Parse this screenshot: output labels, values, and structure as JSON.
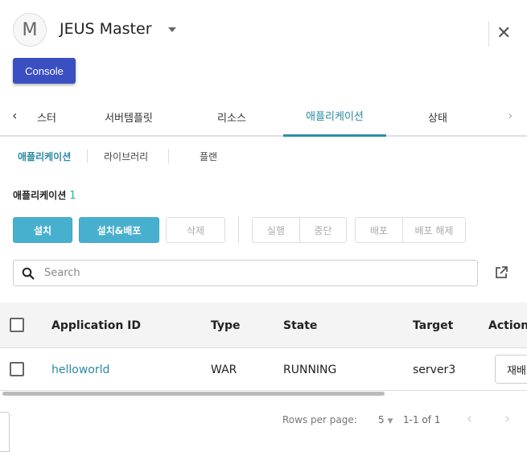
{
  "header": {
    "avatar_letter": "M",
    "title": "JEUS Master",
    "console_label": "Console"
  },
  "tabs": [
    {
      "label": "스터"
    },
    {
      "label": "서버템플릿"
    },
    {
      "label": "리소스"
    },
    {
      "label": "애플리케이션",
      "active": true
    },
    {
      "label": "상태"
    }
  ],
  "subtabs": [
    {
      "label": "애플리케이션",
      "active": true
    },
    {
      "label": "라이브러리"
    },
    {
      "label": "플랜"
    }
  ],
  "section": {
    "label": "애플리케이션",
    "count": "1"
  },
  "buttons": {
    "install": "설치",
    "install_deploy": "설치&배포",
    "delete": "삭제",
    "run": "실행",
    "stop": "중단",
    "deploy": "배포",
    "undeploy": "배포 해제"
  },
  "search": {
    "placeholder": "Search",
    "value": ""
  },
  "table": {
    "columns": [
      "Application ID",
      "Type",
      "State",
      "Target",
      "Action"
    ],
    "rows": [
      {
        "id": "helloworld",
        "type": "WAR",
        "state": "RUNNING",
        "target": "server3",
        "action": "재배"
      }
    ]
  },
  "pagination": {
    "rows_per_page_label": "Rows per page:",
    "rows_per_page": "5",
    "range": "1-1 of 1"
  },
  "colors": {
    "primary": "#3a4fc1",
    "accent": "#48b0cf",
    "link": "#2a8aa3",
    "count": "#1bb89a"
  }
}
